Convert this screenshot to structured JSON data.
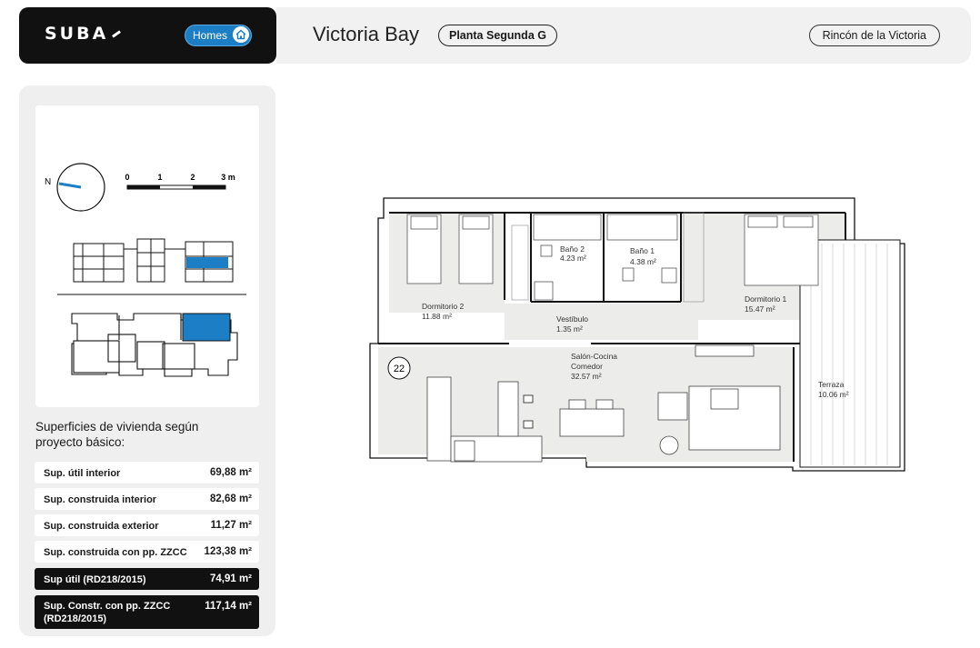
{
  "header": {
    "brand": "SUBA",
    "homes_label": "Homes",
    "project_title": "Victoria Bay",
    "floor_label": "Planta Segunda G",
    "location_label": "Rincón de la Victoria"
  },
  "keyplan": {
    "compass_label": "N",
    "scale_ticks": [
      "0",
      "1",
      "2",
      "3 m"
    ]
  },
  "surfaces": {
    "title": "Superficies de vivienda según proyecto básico:",
    "rows": [
      {
        "label": "Sup. útil interior",
        "value": "69,88",
        "unit": "m²"
      },
      {
        "label": "Sup. construida interior",
        "value": "82,68",
        "unit": "m²"
      },
      {
        "label": "Sup. construida exterior",
        "value": "11,27",
        "unit": "m²"
      },
      {
        "label": "Sup. construida con pp. ZZCC",
        "value": "123,38",
        "unit": "m²"
      },
      {
        "label": "Sup útil (RD218/2015)",
        "value": "74,91",
        "unit": "m²"
      },
      {
        "label": "Sup. Constr. con pp. ZZCC (RD218/2015)",
        "value": "117,14",
        "unit": "m²"
      }
    ]
  },
  "floorplan": {
    "unit_number": "22",
    "rooms": {
      "dormitorio2": {
        "name": "Dormitorio 2",
        "area": "11.88 m²"
      },
      "bano2": {
        "name": "Baño 2",
        "area": "4.23 m²"
      },
      "bano1": {
        "name": "Baño 1",
        "area": "4.38 m²"
      },
      "dormitorio1": {
        "name": "Dormitorio 1",
        "area": "15.47 m²"
      },
      "vestibulo": {
        "name": "Vestíbulo",
        "area": "1.35 m²"
      },
      "salon": {
        "name1": "Salón-Cocina",
        "name2": "Comedor",
        "area": "32.57 m²"
      },
      "terraza": {
        "name": "Terraza",
        "area": "10.06 m²"
      }
    }
  },
  "colors": {
    "accent": "#1c7fc6",
    "dark": "#111111",
    "panel": "#efefef",
    "floor_fill": "#ececea"
  }
}
